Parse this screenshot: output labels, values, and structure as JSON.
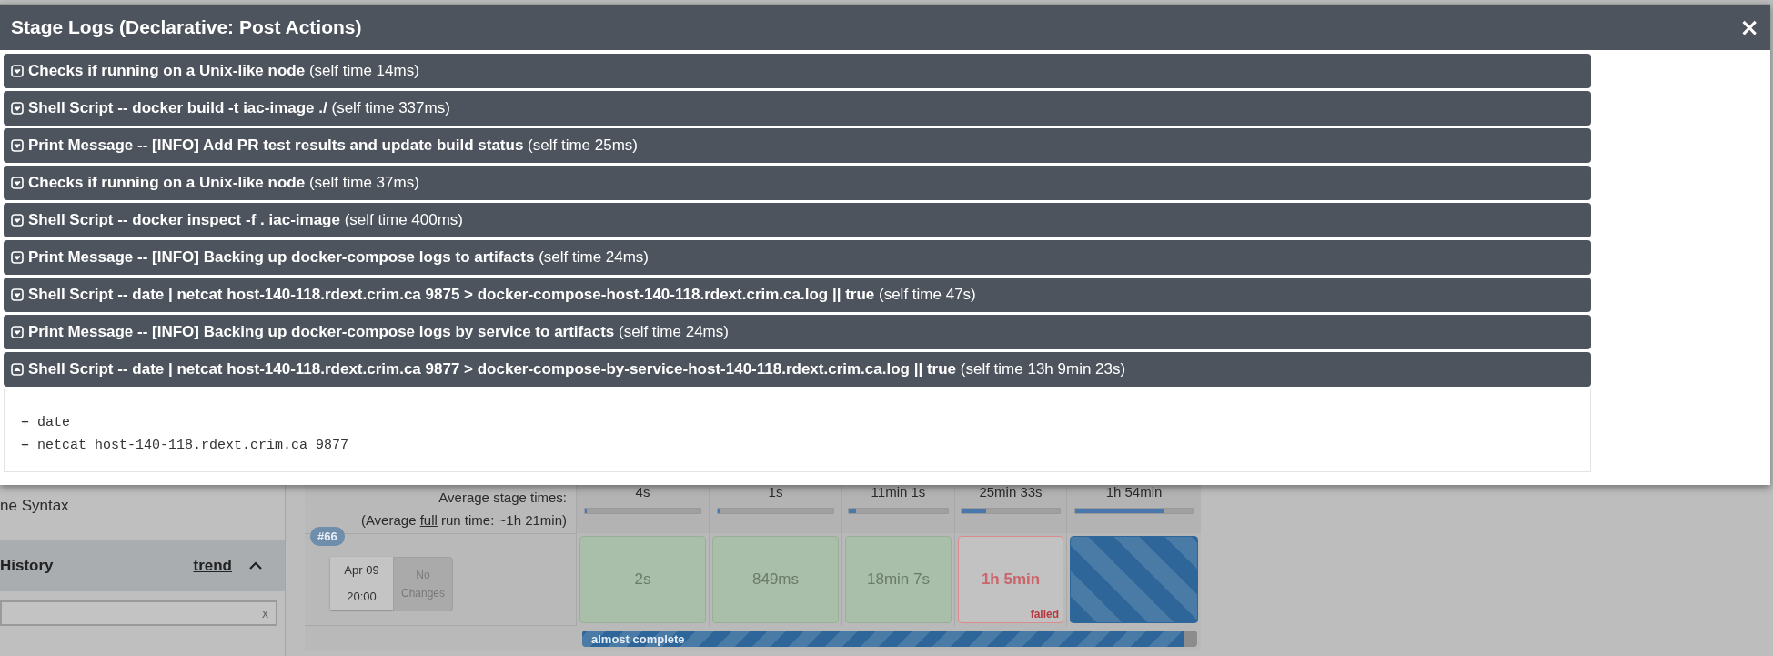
{
  "modal": {
    "title": "Stage Logs (Declarative: Post Actions)",
    "close": "×",
    "steps": [
      {
        "label": "Checks if running on a Unix-like node",
        "self_time": "(self time 14ms)",
        "expanded": false
      },
      {
        "label": "Shell Script -- docker build -t iac-image ./",
        "self_time": "(self time 337ms)",
        "expanded": false
      },
      {
        "label": "Print Message -- [INFO] Add PR test results and update build status",
        "self_time": "(self time 25ms)",
        "expanded": false
      },
      {
        "label": "Checks if running on a Unix-like node",
        "self_time": "(self time 37ms)",
        "expanded": false
      },
      {
        "label": "Shell Script -- docker inspect -f . iac-image",
        "self_time": "(self time 400ms)",
        "expanded": false
      },
      {
        "label": "Print Message -- [INFO] Backing up docker-compose logs to artifacts",
        "self_time": "(self time 24ms)",
        "expanded": false
      },
      {
        "label": "Shell Script -- date | netcat host-140-118.rdext.crim.ca 9875 > docker-compose-host-140-118.rdext.crim.ca.log || true",
        "self_time": "(self time 47s)",
        "expanded": false
      },
      {
        "label": "Print Message -- [INFO] Backing up docker-compose logs by service to artifacts",
        "self_time": "(self time 24ms)",
        "expanded": false
      },
      {
        "label": "Shell Script -- date | netcat host-140-118.rdext.crim.ca 9877 > docker-compose-by-service-host-140-118.rdext.crim.ca.log || true",
        "self_time": "(self time 13h 9min 23s)",
        "expanded": true
      }
    ],
    "log_lines": [
      "+ date",
      "+ netcat host-140-118.rdext.crim.ca 9877"
    ]
  },
  "sidebar": {
    "link": "ne Syntax",
    "history_title": "History",
    "trend_link": "trend",
    "filter_clear": "x"
  },
  "stage_view": {
    "average_label": "Average stage times:",
    "run_time_prefix": "(Average ",
    "run_time_link": "full",
    "run_time_suffix": " run time: ~1h 21min)",
    "columns": [
      {
        "average": "4s",
        "level": 0.02
      },
      {
        "average": "1s",
        "level": 0.02
      },
      {
        "average": "11min 1s",
        "level": 0.07
      },
      {
        "average": "25min 33s",
        "level": 0.25
      },
      {
        "average": "1h 54min",
        "level": 0.75
      }
    ],
    "build": {
      "number": "#66",
      "date": "Apr 09",
      "time": "20:00",
      "changes": "No Changes"
    },
    "cells": [
      {
        "kind": "success",
        "duration": "2s"
      },
      {
        "kind": "success",
        "duration": "849ms"
      },
      {
        "kind": "success",
        "duration": "18min 7s"
      },
      {
        "kind": "failed",
        "duration": "1h 5min",
        "status": "failed"
      },
      {
        "kind": "running"
      }
    ],
    "progress": {
      "label": "almost complete",
      "level": 0.98
    }
  }
}
